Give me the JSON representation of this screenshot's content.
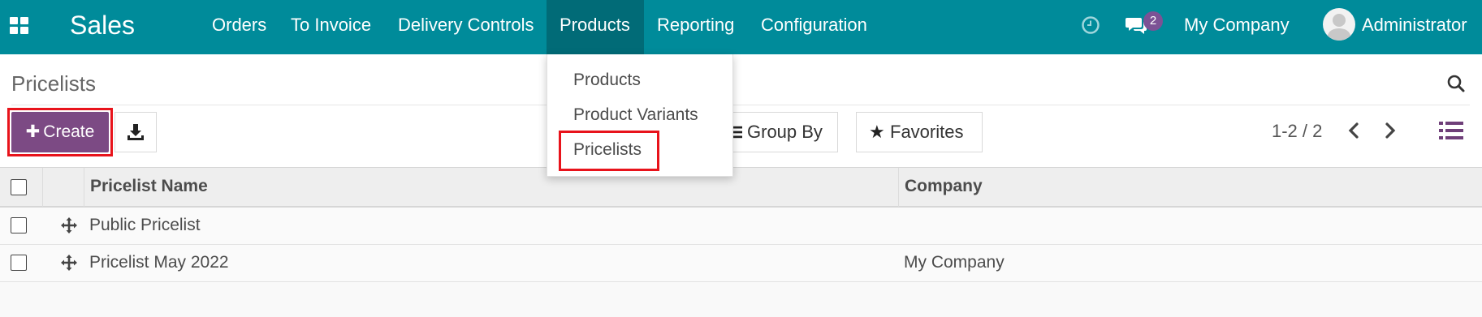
{
  "navbar": {
    "icon": "apps-grid-icon",
    "app_name": "Sales",
    "menu": [
      "Orders",
      "To Invoice",
      "Delivery Controls",
      "Products",
      "Reporting",
      "Configuration"
    ],
    "active_menu": "Products",
    "message_count": "2",
    "company": "My Company",
    "user": "Administrator",
    "colors": {
      "bar": "#008b9a",
      "active": "#016b77",
      "badge": "#7c5295"
    }
  },
  "products_dropdown": {
    "items": [
      "Products",
      "Product Variants",
      "Pricelists"
    ],
    "highlighted_item": "Pricelists"
  },
  "control_panel": {
    "title": "Pricelists",
    "create_label": "Create",
    "group_by_label": "Group By",
    "favorites_label": "Favorites",
    "pager": "1-2 / 2",
    "colors": {
      "create_button": "#7c4a84",
      "highlight": "#e8131b"
    }
  },
  "table": {
    "columns": [
      "Pricelist Name",
      "Company"
    ],
    "rows": [
      {
        "name": "Public Pricelist",
        "company": ""
      },
      {
        "name": "Pricelist May 2022",
        "company": "My Company"
      }
    ]
  }
}
